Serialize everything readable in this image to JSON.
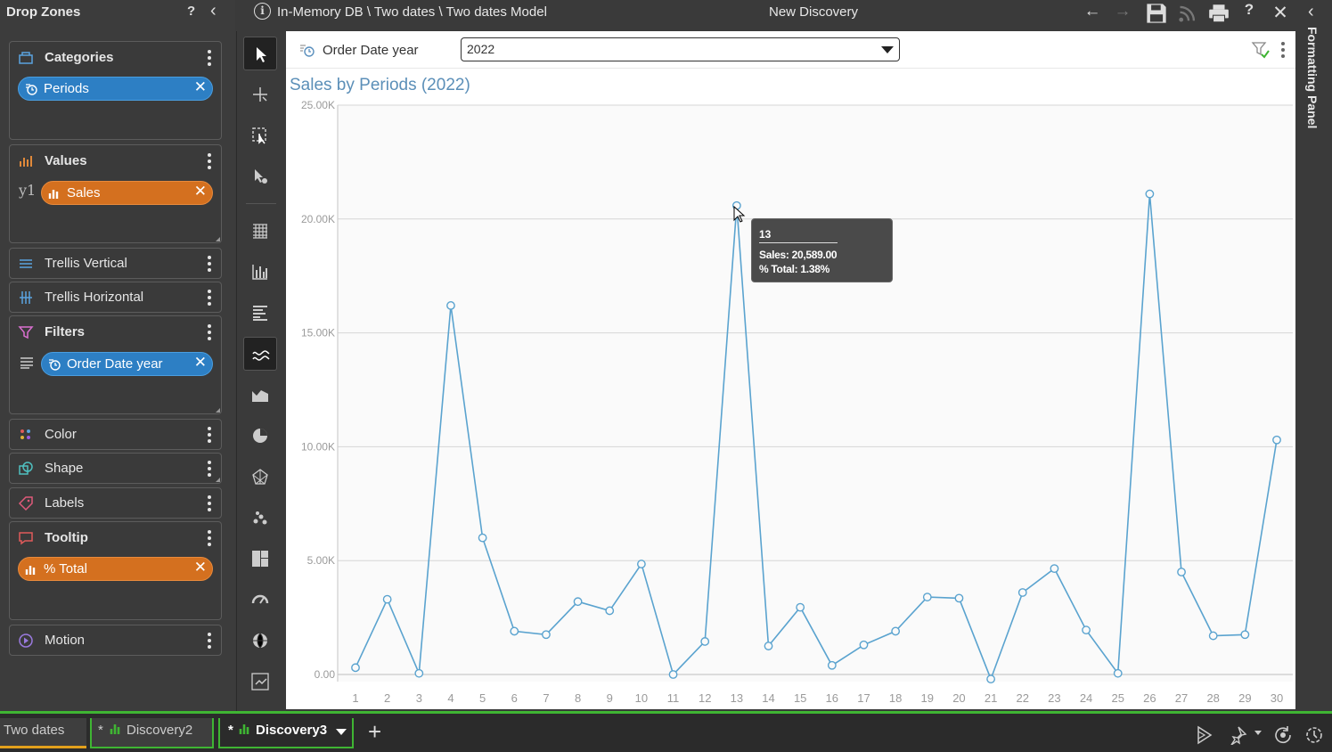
{
  "drop_zones": {
    "title": "Drop Zones",
    "help": "?",
    "zones": {
      "categories": {
        "label": "Categories",
        "pill": "Periods"
      },
      "values": {
        "label": "Values",
        "axis": "y1",
        "pill": "Sales"
      },
      "trellis_v": {
        "label": "Trellis Vertical"
      },
      "trellis_h": {
        "label": "Trellis Horizontal"
      },
      "filters": {
        "label": "Filters",
        "pill": "Order Date year"
      },
      "color": {
        "label": "Color"
      },
      "shape": {
        "label": "Shape"
      },
      "labels": {
        "label": "Labels"
      },
      "tooltip": {
        "label": "Tooltip",
        "pill": "% Total"
      },
      "motion": {
        "label": "Motion"
      }
    }
  },
  "header": {
    "breadcrumb": "In-Memory DB \\ Two dates \\ Two dates Model",
    "title": "New Discovery"
  },
  "formatting_panel": {
    "label": "Formatting Panel"
  },
  "filter_bar": {
    "label": "Order Date year",
    "selected": "2022"
  },
  "tooltip": {
    "title": "13",
    "sales": "Sales: 20,589.00",
    "total": "% Total: 1.38%"
  },
  "tabs": [
    {
      "label": "Two dates",
      "modified": ""
    },
    {
      "label": "Discovery2",
      "modified": "*"
    },
    {
      "label": "Discovery3",
      "modified": "*"
    }
  ],
  "colors": {
    "line": "#5aa3cf",
    "blue_pill": "#2d7fc4",
    "orange_pill": "#d4701f",
    "tab_active_border": "#3fb533",
    "tab_first_underline": "#e2a01c"
  },
  "chart_data": {
    "type": "line",
    "title": "Sales by Periods (2022)",
    "xlabel": "",
    "ylabel": "",
    "categories": [
      "1",
      "2",
      "3",
      "4",
      "5",
      "6",
      "7",
      "8",
      "9",
      "10",
      "11",
      "12",
      "13",
      "14",
      "15",
      "16",
      "17",
      "18",
      "19",
      "20",
      "21",
      "22",
      "23",
      "24",
      "25",
      "26",
      "27",
      "28",
      "29",
      "30"
    ],
    "series": [
      {
        "name": "Sales",
        "values": [
          300,
          3300,
          50,
          16200,
          6000,
          1900,
          1750,
          3200,
          2800,
          4850,
          0,
          1450,
          20589,
          1250,
          2950,
          400,
          1300,
          1900,
          3400,
          3350,
          -200,
          3600,
          4650,
          1950,
          50,
          21100,
          4500,
          1700,
          1750,
          10300
        ]
      }
    ],
    "ylim": [
      0,
      25000
    ],
    "yticks": [
      "0.00",
      "5.00K",
      "10.00K",
      "15.00K",
      "20.00K",
      "25.00K"
    ],
    "grid": true
  }
}
